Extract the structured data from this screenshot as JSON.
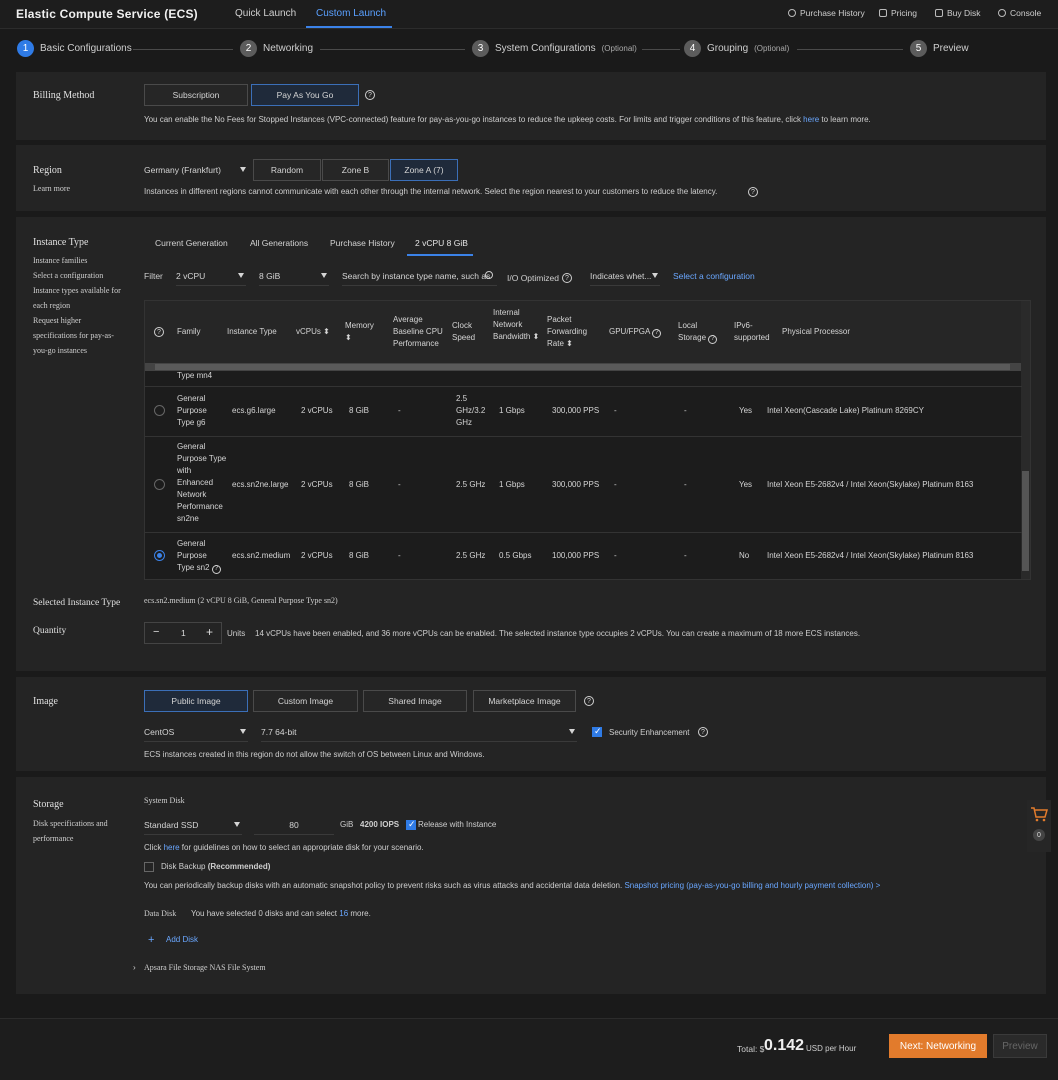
{
  "topnav": {
    "title": "Elastic Compute Service (ECS)",
    "tabs": [
      "Quick Launch",
      "Custom Launch"
    ],
    "links": [
      "Purchase History",
      "Pricing",
      "Buy Disk",
      "Console"
    ]
  },
  "steps": [
    {
      "num": "1",
      "label": "Basic Configurations",
      "opt": ""
    },
    {
      "num": "2",
      "label": "Networking",
      "opt": ""
    },
    {
      "num": "3",
      "label": "System Configurations",
      "opt": "(Optional)"
    },
    {
      "num": "4",
      "label": "Grouping",
      "opt": "(Optional)"
    },
    {
      "num": "5",
      "label": "Preview",
      "opt": ""
    }
  ],
  "billing": {
    "label": "Billing Method",
    "options": [
      "Subscription",
      "Pay As You Go"
    ],
    "note_pre": "You can enable the No Fees for Stopped Instances (VPC-connected) feature for pay-as-you-go instances to reduce the upkeep costs. For limits and trigger conditions of this feature, click ",
    "note_link": "here",
    "note_post": " to learn more."
  },
  "region": {
    "label": "Region",
    "learn_more": "Learn more",
    "selected": "Germany (Frankfurt)",
    "zones": [
      "Random",
      "Zone B",
      "Zone A (7)"
    ],
    "note": "Instances in different regions cannot communicate with each other through the internal network. Select the region nearest to your customers to reduce the latency."
  },
  "instance": {
    "label": "Instance Type",
    "side_links": [
      "Instance families",
      "Select a configuration",
      "Instance types available for",
      "each region",
      "Request higher",
      "specifications for pay-as-",
      "you-go instances"
    ],
    "tabs": [
      "Current Generation",
      "All Generations",
      "Purchase History",
      "2 vCPU 8 GiB"
    ],
    "filter_label": "Filter",
    "vcpu_filter": "2 vCPU",
    "mem_filter": "8 GiB",
    "search_placeholder": "Search by instance type name, such as",
    "io_optimized": "I/O Optimized",
    "indicates": "Indicates whet...",
    "select_config": "Select a configuration",
    "columns": [
      "Family",
      "Instance Type",
      "vCPUs",
      "Memory",
      "Average Baseline CPU Performance",
      "Clock Speed",
      "Internal Network Bandwidth",
      "Packet Forwarding Rate",
      "GPU/FPGA",
      "Local Storage",
      "IPv6-supported",
      "Physical Processor"
    ],
    "partial_row": "Type mn4",
    "rows": [
      {
        "family": "General Purpose Type g6",
        "type": "ecs.g6.large",
        "vcpus": "2 vCPUs",
        "memory": "8 GiB",
        "baseline": "-",
        "clock": "2.5 GHz/3.2 GHz",
        "bandwidth": "1 Gbps",
        "pps": "300,000 PPS",
        "gpu": "-",
        "storage": "-",
        "ipv6": "Yes",
        "cpu": "Intel Xeon(Cascade Lake) Platinum 8269CY"
      },
      {
        "family": "General Purpose Type with Enhanced Network Performance sn2ne",
        "type": "ecs.sn2ne.large",
        "vcpus": "2 vCPUs",
        "memory": "8 GiB",
        "baseline": "-",
        "clock": "2.5 GHz",
        "bandwidth": "1 Gbps",
        "pps": "300,000 PPS",
        "gpu": "-",
        "storage": "-",
        "ipv6": "Yes",
        "cpu": "Intel Xeon E5-2682v4 / Intel Xeon(Skylake) Platinum 8163"
      },
      {
        "family": "General Purpose Type sn2",
        "type": "ecs.sn2.medium",
        "vcpus": "2 vCPUs",
        "memory": "8 GiB",
        "baseline": "-",
        "clock": "2.5 GHz",
        "bandwidth": "0.5 Gbps",
        "pps": "100,000 PPS",
        "gpu": "-",
        "storage": "-",
        "ipv6": "No",
        "cpu": "Intel Xeon E5-2682v4 / Intel Xeon(Skylake) Platinum 8163"
      }
    ],
    "selected_label": "Selected Instance Type",
    "selected_value": "ecs.sn2.medium (2 vCPU 8 GiB, General Purpose Type sn2)",
    "quantity_label": "Quantity",
    "quantity": "1",
    "units": "Units",
    "quota_note": "14 vCPUs have been enabled, and 36 more vCPUs can be enabled. The selected instance type occupies 2 vCPUs. You can create a maximum of 18 more ECS instances."
  },
  "image": {
    "label": "Image",
    "tabs": [
      "Public Image",
      "Custom Image",
      "Shared Image",
      "Marketplace Image"
    ],
    "os": "CentOS",
    "version": "7.7 64-bit",
    "security": "Security Enhancement",
    "note": "ECS instances created in this region do not allow the switch of OS between Linux and Windows."
  },
  "storage": {
    "label": "Storage",
    "side_links": [
      "Disk specifications and",
      "performance"
    ],
    "system_disk": "System Disk",
    "disk_type": "Standard SSD",
    "size": "80",
    "unit": "GiB",
    "iops": "4200 IOPS",
    "release": "Release with Instance",
    "click_pre": "Click ",
    "click_link": "here",
    "click_post": " for guidelines on how to select an appropriate disk for your scenario.",
    "backup": "Disk Backup",
    "backup_rec": "(Recommended)",
    "backup_note": "You can periodically backup disks with an automatic snapshot policy to prevent risks such as virus attacks and accidental data deletion.",
    "snapshot_link": "Snapshot pricing (pay-as-you-go billing and hourly payment collection) >",
    "data_disk": "Data Disk",
    "data_note_pre": "You have selected 0 disks and can select ",
    "data_note_num": "16",
    "data_note_post": " more.",
    "add_disk": "Add Disk",
    "nas": "Apsara File Storage NAS File System"
  },
  "cart": {
    "count": "0"
  },
  "footer": {
    "total_label": "Total: $",
    "total": "0.142",
    "per": "USD per Hour",
    "next": "Next: Networking",
    "preview": "Preview"
  }
}
